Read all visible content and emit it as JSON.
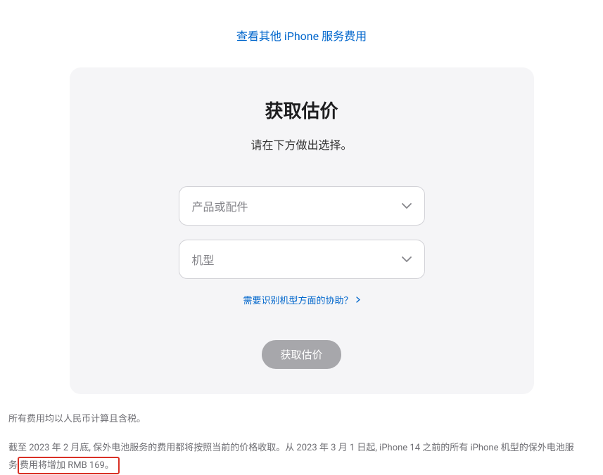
{
  "topLink": "查看其他 iPhone 服务费用",
  "card": {
    "title": "获取估价",
    "subtitle": "请在下方做出选择。",
    "select1": "产品或配件",
    "select2": "机型",
    "helpLink": "需要识别机型方面的协助？",
    "submitButton": "获取估价"
  },
  "footerLine1": "所有费用均以人民币计算且含税。",
  "footerLine2a": "截至 2023 年 2 月底, 保外电池服务的费用都将按照当前的价格收取。从 2023 年 3 月 1 日起, iPhone 14 之前的所有 iPhone 机型的保外电池服",
  "footerLine2b": "务",
  "footerHighlight": "费用将增加 RMB 169。"
}
